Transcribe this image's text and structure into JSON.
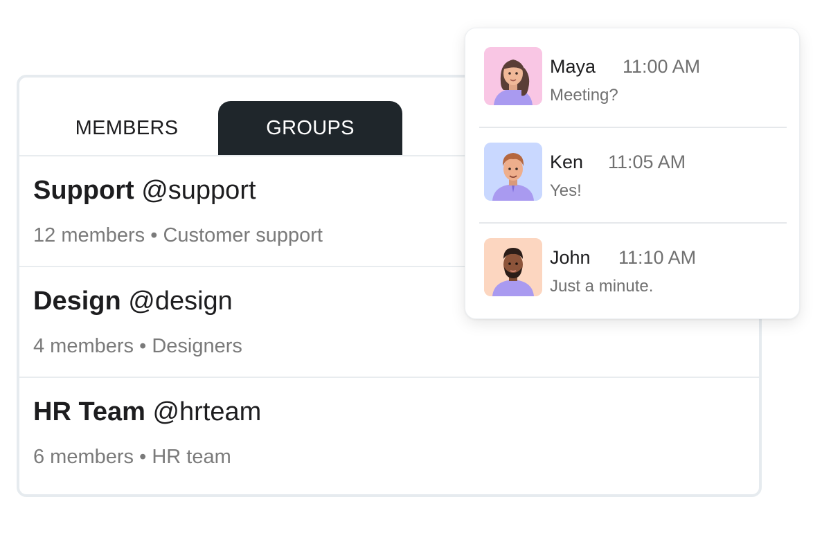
{
  "tabs": {
    "members_label": "MEMBERS",
    "groups_label": "GROUPS",
    "active": "GROUPS"
  },
  "groups": [
    {
      "name": "Support",
      "handle": "@support",
      "members": "12 members",
      "separator": "•",
      "description": "Customer support"
    },
    {
      "name": "Design",
      "handle": "@design",
      "members": "4 members",
      "separator": "•",
      "description": "Designers"
    },
    {
      "name": "HR Team",
      "handle": "@hrteam",
      "members": "6 members",
      "separator": "•",
      "description": "HR team"
    }
  ],
  "messages": [
    {
      "name": "Maya",
      "time": "11:00 AM",
      "text": "Meeting?",
      "avatar_bg": "#f9c6e4",
      "avatar_icon": "woman-avatar-icon"
    },
    {
      "name": "Ken",
      "time": "11:05 AM",
      "text": "Yes!",
      "avatar_bg": "#c9d8ff",
      "avatar_icon": "man-avatar-icon"
    },
    {
      "name": "John",
      "time": "11:10 AM",
      "text": "Just a minute.",
      "avatar_bg": "#fcd6c0",
      "avatar_icon": "bearded-man-avatar-icon"
    }
  ],
  "colors": {
    "active_tab_bg": "#1f262b",
    "secondary_text": "#7a7a7a",
    "border": "#e6ebef"
  }
}
